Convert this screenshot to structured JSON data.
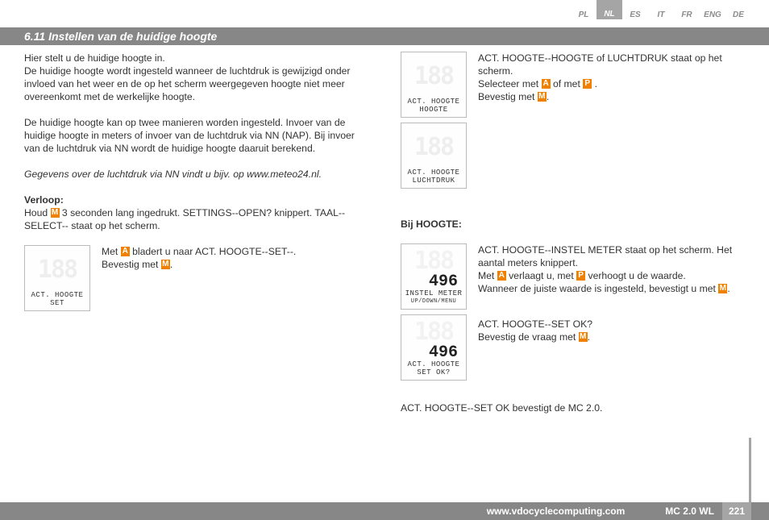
{
  "langs": [
    "PL",
    "NL",
    "ES",
    "IT",
    "FR",
    "ENG",
    "DE"
  ],
  "active_lang": "NL",
  "title": "6.11 Instellen van de huidige hoogte",
  "left": {
    "p1": "Hier stelt u de huidige hoogte in.\nDe huidige hoogte wordt ingesteld wanneer de luchtdruk is gewijzigd onder invloed van het weer en de op het scherm weergegeven hoogte niet meer overeenkomt met de werkelijke hoogte.",
    "p2": "De huidige hoogte kan op twee manieren worden ingesteld. Invoer van de huidige hoogte in meters of invoer van de luchtdruk via NN (NAP). Bij invoer van de luchtdruk via NN wordt de huidige hoogte daaruit berekend.",
    "p3": "Gegevens over de luchtdruk via NN vindt u bijv. op www.meteo24.nl.",
    "verloop_h": "Verloop:",
    "verloop_1a": "Houd ",
    "verloop_1b": " 3 seconden lang ingedrukt. SETTINGS--OPEN? knippert. TAAL--SELECT-- staat op het scherm.",
    "set_a": "Met ",
    "set_b": " bladert u naar ACT. HOOGTE--SET--.",
    "set_c": "Bevestig met ",
    "lcd_set_l1": "ACT. HOOGTE",
    "lcd_set_l2": "SET"
  },
  "right": {
    "r1_a": "ACT. HOOGTE--HOOGTE of LUCHTDRUK staat op het scherm.",
    "r1_b": "Selecteer met ",
    "r1_c": " of met ",
    "r1_d": "Bevestig met ",
    "lcd_h_l1": "ACT. HOOGTE",
    "lcd_h_l2": "HOOGTE",
    "lcd_l_l1": "ACT. HOOGTE",
    "lcd_l_l2": "LUCHTDRUK",
    "bij_h": "Bij HOOGTE:",
    "r2_a": "ACT. HOOGTE--INSTEL METER staat op het scherm. Het aantal meters knippert.",
    "r2_b1": "Met ",
    "r2_b2": " verlaagt u, met ",
    "r2_b3": " verhoogt u de waarde.",
    "r2_c1": "Wanneer de juiste waarde is ingesteld, bevestigt u met ",
    "lcd_im_num": "496",
    "lcd_im_l1": "INSTEL METER",
    "lcd_im_l2": "UP/DOWN/MENU",
    "r3_a": "ACT. HOOGTE--SET OK?",
    "r3_b": "Bevestig de vraag met ",
    "lcd_ok_num": "496",
    "lcd_ok_l1": "ACT. HOOGTE",
    "lcd_ok_l2": "SET OK?",
    "r4": "ACT. HOOGTE--SET OK bevestigt de MC 2.0."
  },
  "footer": {
    "url": "www.vdocyclecomputing.com",
    "model": "MC 2.0 WL",
    "page": "221"
  },
  "keys": {
    "M": "M",
    "A": "A",
    "P": "P"
  }
}
